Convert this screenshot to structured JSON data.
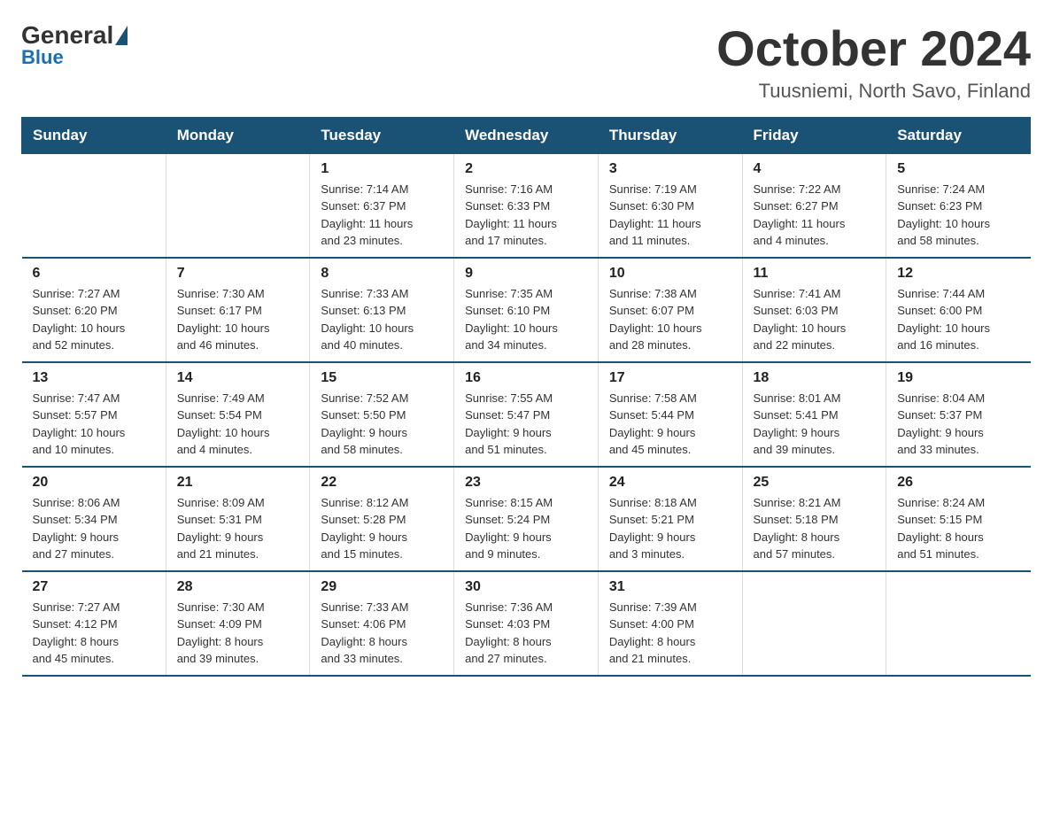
{
  "logo": {
    "general": "General",
    "blue": "Blue"
  },
  "title": "October 2024",
  "location": "Tuusniemi, North Savo, Finland",
  "days_of_week": [
    "Sunday",
    "Monday",
    "Tuesday",
    "Wednesday",
    "Thursday",
    "Friday",
    "Saturday"
  ],
  "weeks": [
    [
      {
        "day": "",
        "info": ""
      },
      {
        "day": "",
        "info": ""
      },
      {
        "day": "1",
        "info": "Sunrise: 7:14 AM\nSunset: 6:37 PM\nDaylight: 11 hours\nand 23 minutes."
      },
      {
        "day": "2",
        "info": "Sunrise: 7:16 AM\nSunset: 6:33 PM\nDaylight: 11 hours\nand 17 minutes."
      },
      {
        "day": "3",
        "info": "Sunrise: 7:19 AM\nSunset: 6:30 PM\nDaylight: 11 hours\nand 11 minutes."
      },
      {
        "day": "4",
        "info": "Sunrise: 7:22 AM\nSunset: 6:27 PM\nDaylight: 11 hours\nand 4 minutes."
      },
      {
        "day": "5",
        "info": "Sunrise: 7:24 AM\nSunset: 6:23 PM\nDaylight: 10 hours\nand 58 minutes."
      }
    ],
    [
      {
        "day": "6",
        "info": "Sunrise: 7:27 AM\nSunset: 6:20 PM\nDaylight: 10 hours\nand 52 minutes."
      },
      {
        "day": "7",
        "info": "Sunrise: 7:30 AM\nSunset: 6:17 PM\nDaylight: 10 hours\nand 46 minutes."
      },
      {
        "day": "8",
        "info": "Sunrise: 7:33 AM\nSunset: 6:13 PM\nDaylight: 10 hours\nand 40 minutes."
      },
      {
        "day": "9",
        "info": "Sunrise: 7:35 AM\nSunset: 6:10 PM\nDaylight: 10 hours\nand 34 minutes."
      },
      {
        "day": "10",
        "info": "Sunrise: 7:38 AM\nSunset: 6:07 PM\nDaylight: 10 hours\nand 28 minutes."
      },
      {
        "day": "11",
        "info": "Sunrise: 7:41 AM\nSunset: 6:03 PM\nDaylight: 10 hours\nand 22 minutes."
      },
      {
        "day": "12",
        "info": "Sunrise: 7:44 AM\nSunset: 6:00 PM\nDaylight: 10 hours\nand 16 minutes."
      }
    ],
    [
      {
        "day": "13",
        "info": "Sunrise: 7:47 AM\nSunset: 5:57 PM\nDaylight: 10 hours\nand 10 minutes."
      },
      {
        "day": "14",
        "info": "Sunrise: 7:49 AM\nSunset: 5:54 PM\nDaylight: 10 hours\nand 4 minutes."
      },
      {
        "day": "15",
        "info": "Sunrise: 7:52 AM\nSunset: 5:50 PM\nDaylight: 9 hours\nand 58 minutes."
      },
      {
        "day": "16",
        "info": "Sunrise: 7:55 AM\nSunset: 5:47 PM\nDaylight: 9 hours\nand 51 minutes."
      },
      {
        "day": "17",
        "info": "Sunrise: 7:58 AM\nSunset: 5:44 PM\nDaylight: 9 hours\nand 45 minutes."
      },
      {
        "day": "18",
        "info": "Sunrise: 8:01 AM\nSunset: 5:41 PM\nDaylight: 9 hours\nand 39 minutes."
      },
      {
        "day": "19",
        "info": "Sunrise: 8:04 AM\nSunset: 5:37 PM\nDaylight: 9 hours\nand 33 minutes."
      }
    ],
    [
      {
        "day": "20",
        "info": "Sunrise: 8:06 AM\nSunset: 5:34 PM\nDaylight: 9 hours\nand 27 minutes."
      },
      {
        "day": "21",
        "info": "Sunrise: 8:09 AM\nSunset: 5:31 PM\nDaylight: 9 hours\nand 21 minutes."
      },
      {
        "day": "22",
        "info": "Sunrise: 8:12 AM\nSunset: 5:28 PM\nDaylight: 9 hours\nand 15 minutes."
      },
      {
        "day": "23",
        "info": "Sunrise: 8:15 AM\nSunset: 5:24 PM\nDaylight: 9 hours\nand 9 minutes."
      },
      {
        "day": "24",
        "info": "Sunrise: 8:18 AM\nSunset: 5:21 PM\nDaylight: 9 hours\nand 3 minutes."
      },
      {
        "day": "25",
        "info": "Sunrise: 8:21 AM\nSunset: 5:18 PM\nDaylight: 8 hours\nand 57 minutes."
      },
      {
        "day": "26",
        "info": "Sunrise: 8:24 AM\nSunset: 5:15 PM\nDaylight: 8 hours\nand 51 minutes."
      }
    ],
    [
      {
        "day": "27",
        "info": "Sunrise: 7:27 AM\nSunset: 4:12 PM\nDaylight: 8 hours\nand 45 minutes."
      },
      {
        "day": "28",
        "info": "Sunrise: 7:30 AM\nSunset: 4:09 PM\nDaylight: 8 hours\nand 39 minutes."
      },
      {
        "day": "29",
        "info": "Sunrise: 7:33 AM\nSunset: 4:06 PM\nDaylight: 8 hours\nand 33 minutes."
      },
      {
        "day": "30",
        "info": "Sunrise: 7:36 AM\nSunset: 4:03 PM\nDaylight: 8 hours\nand 27 minutes."
      },
      {
        "day": "31",
        "info": "Sunrise: 7:39 AM\nSunset: 4:00 PM\nDaylight: 8 hours\nand 21 minutes."
      },
      {
        "day": "",
        "info": ""
      },
      {
        "day": "",
        "info": ""
      }
    ]
  ]
}
